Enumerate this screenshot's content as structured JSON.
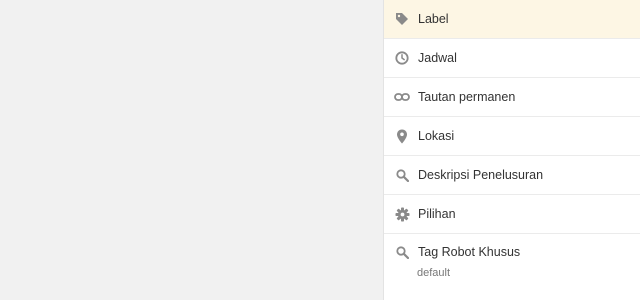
{
  "colors": {
    "background": "#f1f1f1",
    "panel": "#ffffff",
    "active_item": "#fdf6e4",
    "icon": "#8a8a8a",
    "text": "#333333",
    "pointer_arrow": "#e02020"
  },
  "sidebar": {
    "items": [
      {
        "label": "Label",
        "icon": "tag-icon",
        "active": true
      },
      {
        "label": "Jadwal",
        "icon": "clock-icon"
      },
      {
        "label": "Tautan permanen",
        "icon": "link-icon"
      },
      {
        "label": "Lokasi",
        "icon": "location-pin-icon"
      },
      {
        "label": "Deskripsi Penelusuran",
        "icon": "search-icon"
      },
      {
        "label": "Pilihan",
        "icon": "gear-icon"
      },
      {
        "label": "Tag Robot Khusus",
        "icon": "search-icon",
        "value": "default"
      }
    ]
  }
}
